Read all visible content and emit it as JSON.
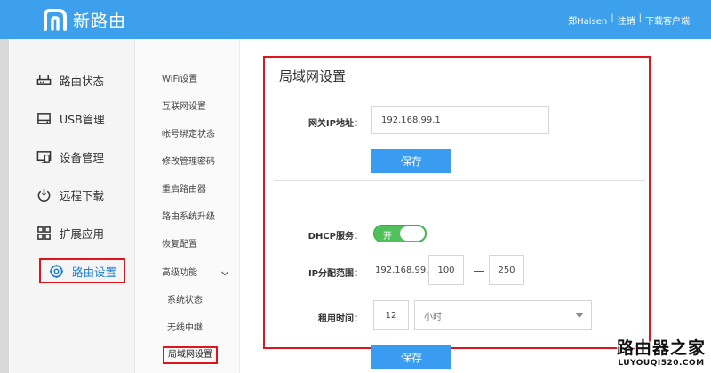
{
  "header": {
    "brand": "新路由",
    "user": "郑Haisen",
    "sep1": "|",
    "logout": "注销",
    "sep2": "|",
    "download": "下载客户端"
  },
  "sidebar": {
    "items": [
      {
        "label": "路由状态",
        "icon": "router-icon"
      },
      {
        "label": "USB管理",
        "icon": "usb-drive-icon"
      },
      {
        "label": "设备管理",
        "icon": "monitor-icon"
      },
      {
        "label": "远程下载",
        "icon": "power-download-icon"
      },
      {
        "label": "扩展应用",
        "icon": "apps-grid-icon"
      },
      {
        "label": "路由设置",
        "icon": "gear-icon",
        "active": true
      }
    ]
  },
  "subnav": {
    "items": [
      "WiFi设置",
      "互联网设置",
      "帐号绑定状态",
      "修改管理密码",
      "重启路由器",
      "路由系统升级",
      "恢复配置",
      "高级功能",
      "系统状态",
      "无线中继",
      "局域网设置"
    ]
  },
  "lan": {
    "title": "局域网设置",
    "gateway_label": "网关IP地址：",
    "gateway_value": "192.168.99.1",
    "save_label": "保存",
    "dhcp_label": "DHCP服务：",
    "dhcp_state": "开",
    "range_label": "IP分配范围：",
    "range_prefix": "192.168.99.",
    "range_start": "100",
    "range_end": "250",
    "lease_label": "租用时间：",
    "lease_value": "12",
    "lease_unit": "小时",
    "save_label2": "保存"
  },
  "watermark": {
    "title": "路由器之家",
    "url": "LUYOUQI520.COM"
  },
  "colors": {
    "header": "#3da0ec",
    "button": "#3a9cf0",
    "toggle_on": "#4fc05a",
    "highlight": "#e0141c"
  }
}
